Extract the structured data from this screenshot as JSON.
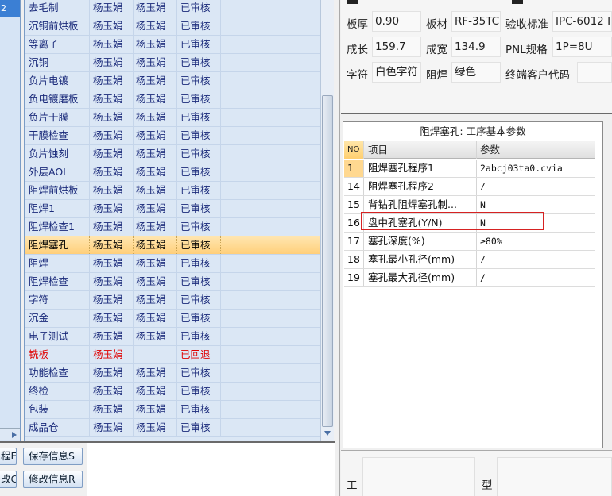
{
  "left_strip": {
    "top_cell": "2"
  },
  "process_grid": {
    "rows": [
      {
        "step": "去毛制",
        "c2": "杨玉娟",
        "c3": "杨玉娟",
        "status": "已审核",
        "state": "normal"
      },
      {
        "step": "沉铜前烘板",
        "c2": "杨玉娟",
        "c3": "杨玉娟",
        "status": "已审核",
        "state": "normal"
      },
      {
        "step": "等离子",
        "c2": "杨玉娟",
        "c3": "杨玉娟",
        "status": "已审核",
        "state": "normal"
      },
      {
        "step": "沉铜",
        "c2": "杨玉娟",
        "c3": "杨玉娟",
        "status": "已审核",
        "state": "normal"
      },
      {
        "step": "负片电镀",
        "c2": "杨玉娟",
        "c3": "杨玉娟",
        "status": "已审核",
        "state": "normal"
      },
      {
        "step": "负电镀磨板",
        "c2": "杨玉娟",
        "c3": "杨玉娟",
        "status": "已审核",
        "state": "normal"
      },
      {
        "step": "负片干膜",
        "c2": "杨玉娟",
        "c3": "杨玉娟",
        "status": "已审核",
        "state": "normal"
      },
      {
        "step": "干膜检查",
        "c2": "杨玉娟",
        "c3": "杨玉娟",
        "status": "已审核",
        "state": "normal"
      },
      {
        "step": "负片蚀刻",
        "c2": "杨玉娟",
        "c3": "杨玉娟",
        "status": "已审核",
        "state": "normal"
      },
      {
        "step": "外层AOI",
        "c2": "杨玉娟",
        "c3": "杨玉娟",
        "status": "已审核",
        "state": "normal"
      },
      {
        "step": "阻焊前烘板",
        "c2": "杨玉娟",
        "c3": "杨玉娟",
        "status": "已审核",
        "state": "normal"
      },
      {
        "step": "阻焊1",
        "c2": "杨玉娟",
        "c3": "杨玉娟",
        "status": "已审核",
        "state": "normal"
      },
      {
        "step": "阻焊检查1",
        "c2": "杨玉娟",
        "c3": "杨玉娟",
        "status": "已审核",
        "state": "normal"
      },
      {
        "step": "阻焊塞孔",
        "c2": "杨玉娟",
        "c3": "杨玉娟",
        "status": "已审核",
        "state": "selected"
      },
      {
        "step": "阻焊",
        "c2": "杨玉娟",
        "c3": "杨玉娟",
        "status": "已审核",
        "state": "normal"
      },
      {
        "step": "阻焊检查",
        "c2": "杨玉娟",
        "c3": "杨玉娟",
        "status": "已审核",
        "state": "normal"
      },
      {
        "step": "字符",
        "c2": "杨玉娟",
        "c3": "杨玉娟",
        "status": "已审核",
        "state": "normal"
      },
      {
        "step": "沉金",
        "c2": "杨玉娟",
        "c3": "杨玉娟",
        "status": "已审核",
        "state": "normal"
      },
      {
        "step": "电子测试",
        "c2": "杨玉娟",
        "c3": "杨玉娟",
        "status": "已审核",
        "state": "normal"
      },
      {
        "step": "铣板",
        "c2": "杨玉娟",
        "c3": "",
        "status": "已回退",
        "state": "returned"
      },
      {
        "step": "功能检查",
        "c2": "杨玉娟",
        "c3": "杨玉娟",
        "status": "已审核",
        "state": "normal"
      },
      {
        "step": "终检",
        "c2": "杨玉娟",
        "c3": "杨玉娟",
        "status": "已审核",
        "state": "normal"
      },
      {
        "step": "包装",
        "c2": "杨玉娟",
        "c3": "杨玉娟",
        "status": "已审核",
        "state": "normal"
      },
      {
        "step": "成品仓",
        "c2": "杨玉娟",
        "c3": "杨玉娟",
        "status": "已审核",
        "state": "normal"
      }
    ]
  },
  "buttons": {
    "partial_left_1": "程E",
    "partial_left_2": "改C",
    "save_info": "保存信息S",
    "modify_info": "修改信息R"
  },
  "board_info": {
    "thickness_label": "板厚",
    "thickness_value": "0.90",
    "material_label": "板材",
    "material_value": "RF-35TC",
    "standard_label": "验收标准",
    "standard_value": "IPC-6012 I",
    "length_label": "成长",
    "length_value": "159.7",
    "width_label": "成宽",
    "width_value": "134.9",
    "pnl_label": "PNL规格",
    "pnl_value": "1P=8U",
    "legend_label": "字符",
    "legend_value": "白色字符",
    "mask_label": "阻焊",
    "mask_value": "绿色",
    "customer_code_label": "终端客户代码",
    "customer_code_value": ""
  },
  "param_table": {
    "title": "阻焊塞孔: 工序基本参数",
    "headers": {
      "no": "NO",
      "item": "项目",
      "param": "参数"
    },
    "rows": [
      {
        "no": "1",
        "item": "阻焊塞孔程序1",
        "param": "2abcj03ta0.cvia"
      },
      {
        "no": "14",
        "item": "阻焊塞孔程序2",
        "param": "/"
      },
      {
        "no": "15",
        "item": "背钻孔阻焊塞孔制...",
        "param": "N"
      },
      {
        "no": "16",
        "item": "盘中孔塞孔(Y/N)",
        "param": "N"
      },
      {
        "no": "17",
        "item": "塞孔深度(%)",
        "param": "≥80%"
      },
      {
        "no": "18",
        "item": "塞孔最小孔径(mm)",
        "param": "/"
      },
      {
        "no": "19",
        "item": "塞孔最大孔径(mm)",
        "param": "/"
      }
    ]
  },
  "bottom_labels": {
    "left": "工",
    "right": "型"
  },
  "colors": {
    "selected_row": "#ffcf7a",
    "returned_text": "#e00000",
    "highlight_box": "#d62222"
  }
}
